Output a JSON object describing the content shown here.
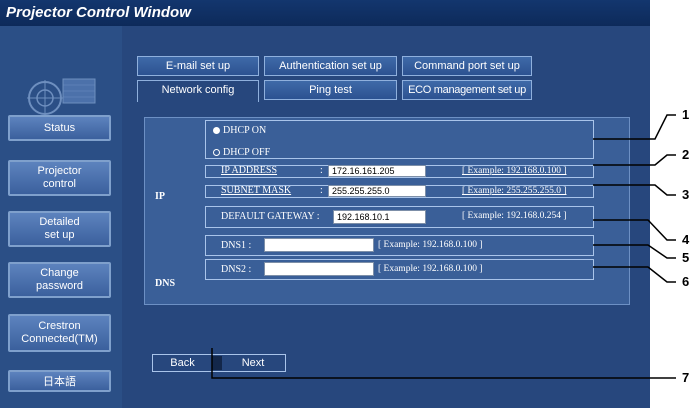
{
  "window": {
    "title": "Projector Control Window"
  },
  "sidebar": {
    "items": [
      {
        "label": "Status"
      },
      {
        "label": "Projector\ncontrol"
      },
      {
        "label": "Detailed\nset up"
      },
      {
        "label": "Change\npassword"
      },
      {
        "label": "Crestron\nConnected(TM)"
      },
      {
        "label": "日本語"
      }
    ]
  },
  "tabs": {
    "row1": [
      "E-mail set up",
      "Authentication set up",
      "Command port set up"
    ],
    "row2": [
      "Network config",
      "Ping test",
      "ECO management set up"
    ],
    "active": "Network config"
  },
  "ip": {
    "section_label": "IP",
    "dhcp_on": "DHCP ON",
    "dhcp_off": "DHCP OFF",
    "dhcp_selected": "DHCP ON",
    "ip_address_label": "IP ADDRESS",
    "ip_address_value": "172.16.161.205",
    "ip_address_example": "[ Example: 192.168.0.100 ]",
    "subnet_label": "SUBNET MASK",
    "subnet_value": "255.255.255.0",
    "subnet_example": "[ Example: 255.255.255.0 ]",
    "gateway_label": "DEFAULT GATEWAY :",
    "gateway_value": "192.168.10.1",
    "gateway_example": "[ Example: 192.168.0.254 ]",
    "colon": ":"
  },
  "dns": {
    "section_label": "DNS",
    "dns1_label": "DNS1 :",
    "dns1_value": "",
    "dns1_example": "[ Example: 192.168.0.100 ]",
    "dns2_label": "DNS2 :",
    "dns2_value": "",
    "dns2_example": "[ Example: 192.168.0.100 ]"
  },
  "nav": {
    "back": "Back",
    "next": "Next"
  },
  "callouts": [
    "1",
    "2",
    "3",
    "4",
    "5",
    "6",
    "7"
  ]
}
